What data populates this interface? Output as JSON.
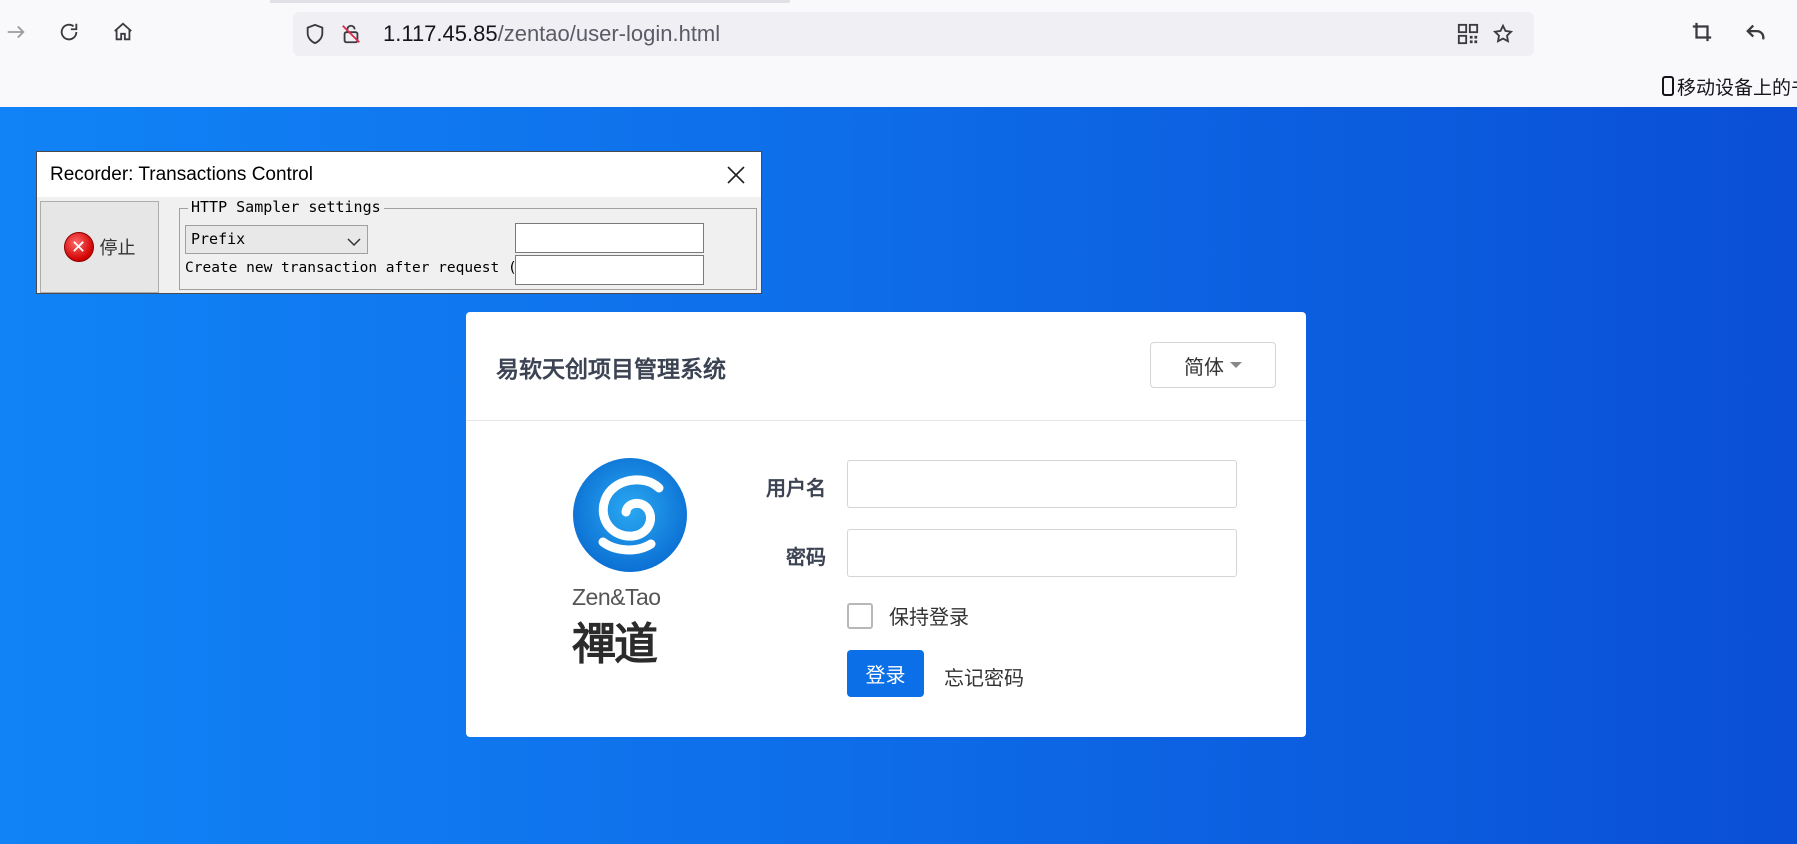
{
  "browser": {
    "url_host": "1.117.45.85",
    "url_path": "/zentao/user-login.html",
    "bookmark_label": "移动设备上的书"
  },
  "recorder": {
    "title": "Recorder: Transactions Control",
    "stop_label": "停止",
    "group_legend": "HTTP Sampler settings",
    "naming_scheme": "Prefix",
    "prefix_value": "",
    "delay_label": "Create new transaction after request (ms):",
    "delay_value": ""
  },
  "login": {
    "system_title": "易软天创项目管理系统",
    "language": "简体",
    "logo_text_en": "Zen&Tao",
    "logo_text_cn": "禪道",
    "username_label": "用户名",
    "username_value": "",
    "password_label": "密码",
    "password_value": "",
    "remember_label": "保持登录",
    "remember_checked": false,
    "login_button": "登录",
    "forgot_link": "忘记密码"
  },
  "colors": {
    "page_gradient_start": "#1183f7",
    "page_gradient_end": "#0a4fd6",
    "primary_button": "#0b6fe8"
  },
  "icons": [
    "forward-icon",
    "reload-icon",
    "home-icon",
    "shield-icon",
    "insecure-lock-icon",
    "qr-code-icon",
    "bookmark-star-icon",
    "crop-icon",
    "undo-icon",
    "close-icon",
    "stop-icon",
    "chevron-down-icon"
  ]
}
